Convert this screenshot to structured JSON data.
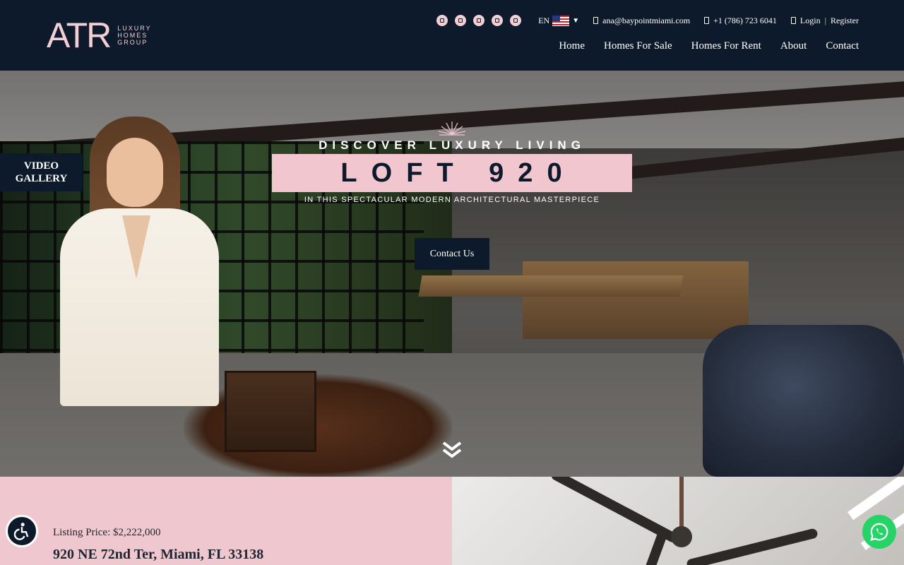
{
  "header": {
    "logo_mark": "ATR",
    "logo_lines": [
      "LUXURY",
      "HOMES",
      "GROUP"
    ],
    "language": "EN",
    "email": "ana@baypointmiami.com",
    "phone": "+1 (786) 723 6041",
    "login": "Login",
    "separator": "|",
    "register": "Register",
    "social_icons": [
      "facebook-icon",
      "instagram-icon",
      "linkedin-icon",
      "youtube-icon",
      "twitter-icon"
    ],
    "nav": [
      "Home",
      "Homes For Sale",
      "Homes For Rent",
      "About",
      "Contact"
    ]
  },
  "hero": {
    "video_gallery": "VIDEO GALLERY",
    "kicker": "DISCOVER LUXURY LIVING",
    "title": "LOFT 920",
    "subtitle": "IN THIS SPECTACULAR MODERN ARCHITECTURAL MASTERPIECE",
    "cta": "Contact Us"
  },
  "listing": {
    "price": "Listing Price: $2,222,000",
    "address": "920 NE 72nd Ter, Miami, FL 33138"
  },
  "colors": {
    "navy": "#0c1a2b",
    "pink": "#f1c6cf",
    "whatsapp": "#25d366"
  }
}
